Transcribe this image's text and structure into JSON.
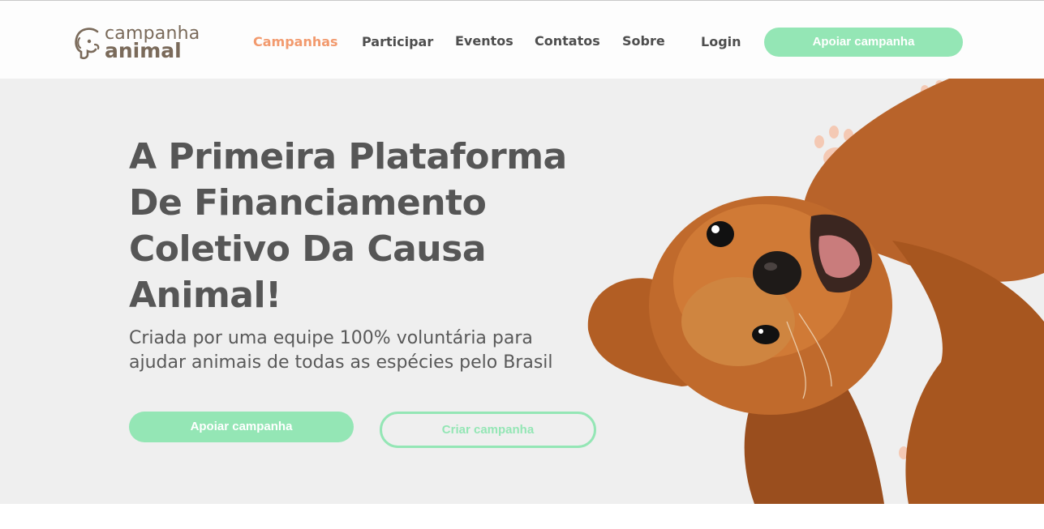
{
  "logo": {
    "line1": "campanha",
    "line2": "animal"
  },
  "nav": {
    "items": [
      {
        "label": "Campanhas",
        "active": true
      },
      {
        "label": "Participar"
      },
      {
        "label": "Eventos"
      },
      {
        "label": "Contatos"
      },
      {
        "label": "Sobre"
      },
      {
        "label": "Login"
      }
    ],
    "cta_label": "Apoiar campanha"
  },
  "hero": {
    "title": "A Primeira Plataforma De Financiamento Coletivo Da Causa Animal!",
    "subtitle": "Criada por uma equipe 100% voluntária para ajudar animais de todas as espécies pelo Brasil",
    "primary_button": "Apoiar campanha",
    "secondary_button": "Criar campanha"
  },
  "colors": {
    "accent_green": "#94e6b5",
    "accent_orange": "#f29a6e",
    "text_dark": "#565656",
    "brand_brown": "#7a6a5a",
    "hero_bg": "#efefef"
  },
  "icons": [
    "dog-head-logo-icon",
    "paw-print-icon"
  ]
}
